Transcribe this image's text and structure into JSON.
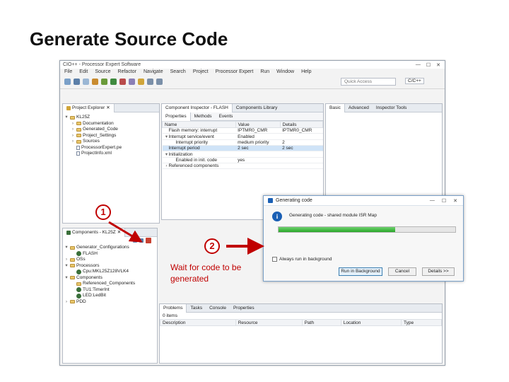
{
  "slide": {
    "title": "Generate Source Code"
  },
  "window": {
    "title": "CIO++ - Processor Expert Software",
    "menus": [
      "File",
      "Edit",
      "Source",
      "Refactor",
      "Navigate",
      "Search",
      "Project",
      "Processor Expert",
      "Run",
      "Window",
      "Help"
    ],
    "quick_access_placeholder": "Quick Access",
    "perspective": "C/C++"
  },
  "project_explorer": {
    "tab": "Project Explorer",
    "items": [
      {
        "label": "KL25Z",
        "kind": "project",
        "indent": 0,
        "toggle": "▾"
      },
      {
        "label": "Documentation",
        "kind": "folder",
        "indent": 1,
        "toggle": "›"
      },
      {
        "label": "Generated_Code",
        "kind": "folder",
        "indent": 1,
        "toggle": "›"
      },
      {
        "label": "Project_Settings",
        "kind": "folder",
        "indent": 1,
        "toggle": "›"
      },
      {
        "label": "Sources",
        "kind": "folder",
        "indent": 1,
        "toggle": "›"
      },
      {
        "label": "ProcessorExpert.pe",
        "kind": "file",
        "indent": 1,
        "toggle": ""
      },
      {
        "label": "ProjectInfo.xml",
        "kind": "file",
        "indent": 1,
        "toggle": ""
      }
    ]
  },
  "inspector": {
    "tabs": [
      "Component Inspector - FLASH",
      "Components Library"
    ],
    "mode_tabs": [
      "Basic",
      "Advanced",
      "Inspector Tools"
    ],
    "sub_tabs": [
      "Properties",
      "Methods",
      "Events"
    ],
    "columns": [
      "Name",
      "Value",
      "Details"
    ],
    "rows": [
      {
        "name": "Flash memory: interrupt",
        "value": "IPTMR0_CMR",
        "details": "IPTMR0_CMR",
        "toggle": "",
        "indent": 0,
        "selected": false
      },
      {
        "name": "Interrupt service/event",
        "value": "Enabled",
        "details": "",
        "toggle": "▾",
        "indent": 0,
        "selected": false
      },
      {
        "name": "Interrupt priority",
        "value": "medium priority",
        "details": "2",
        "toggle": "",
        "indent": 1,
        "selected": false
      },
      {
        "name": "Interrupt period",
        "value": "2 sec",
        "details": "2 sec",
        "toggle": "",
        "indent": 0,
        "selected": true
      },
      {
        "name": "Initialization",
        "value": "",
        "details": "",
        "toggle": "▾",
        "indent": 0,
        "selected": false
      },
      {
        "name": "Enabled in init. code",
        "value": "yes",
        "details": "",
        "toggle": "",
        "indent": 1,
        "selected": false
      },
      {
        "name": "Referenced components",
        "value": "",
        "details": "",
        "toggle": "›",
        "indent": 0,
        "selected": false
      }
    ]
  },
  "components": {
    "tab": "Components - KL25Z",
    "items": [
      {
        "label": "Generator_Configurations",
        "kind": "folder",
        "indent": 0,
        "toggle": "▾"
      },
      {
        "label": "FLASH",
        "kind": "chip",
        "indent": 1,
        "toggle": ""
      },
      {
        "label": "OSs",
        "kind": "folder",
        "indent": 0,
        "toggle": "›"
      },
      {
        "label": "Processors",
        "kind": "folder",
        "indent": 0,
        "toggle": "▾"
      },
      {
        "label": "Cpu:MKL25Z128VLK4",
        "kind": "chip",
        "indent": 1,
        "toggle": ""
      },
      {
        "label": "Components",
        "kind": "folder",
        "indent": 0,
        "toggle": "▾"
      },
      {
        "label": "Referenced_Components",
        "kind": "folder",
        "indent": 1,
        "toggle": ""
      },
      {
        "label": "TU1:TimerInt",
        "kind": "chip",
        "indent": 1,
        "toggle": ""
      },
      {
        "label": "LED:LedBit",
        "kind": "chip",
        "indent": 1,
        "toggle": ""
      },
      {
        "label": "PDD",
        "kind": "folder",
        "indent": 0,
        "toggle": "›"
      }
    ]
  },
  "problems": {
    "tabs": [
      "Problems",
      "Tasks",
      "Console",
      "Properties"
    ],
    "summary": "0 items",
    "columns": [
      "Description",
      "Resource",
      "Path",
      "Location",
      "Type"
    ]
  },
  "dialog": {
    "title": "Generating code",
    "message": "Generating code - shared module ISR Map",
    "progress": 0.66,
    "checkbox_label": "Always run in background",
    "buttons": {
      "background": "Run in Background",
      "cancel": "Cancel",
      "details": "Details >>"
    }
  },
  "annotations": {
    "step1": "1",
    "step2": "2",
    "note": "Wait for code to be generated"
  },
  "colors": {
    "accent": "#c00000",
    "progress": "#2aa72a",
    "selection": "#cfe3f7"
  }
}
